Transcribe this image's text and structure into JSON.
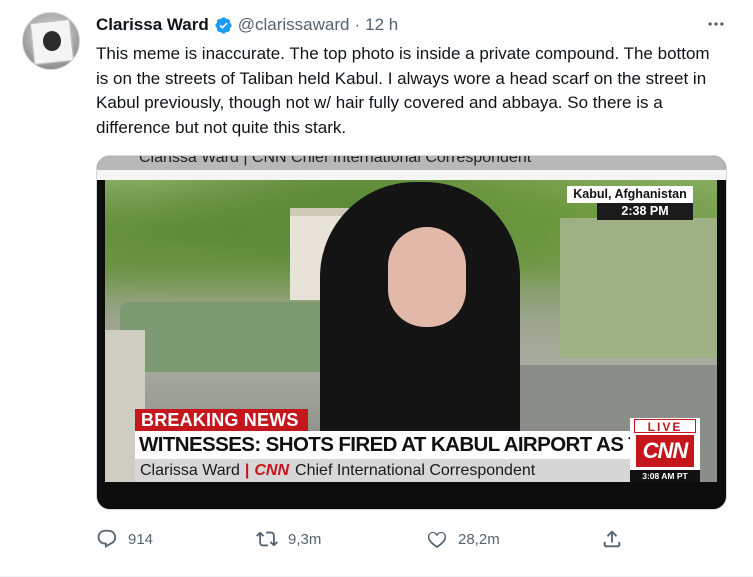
{
  "tweet": {
    "author": {
      "display_name": "Clarissa Ward",
      "handle": "@clarissaward",
      "separator": "·",
      "time": "12 h",
      "verified": true
    },
    "more_icon": "more-horizontal-icon",
    "text": "This meme is inaccurate. The top photo is inside a private compound. The bottom is on the streets of Taliban held Kabul. I always wore a head scarf on the street in Kabul previously, though not w/ hair fully covered and abbaya. So there is a difference but not quite this stark.",
    "media": {
      "top_strip_text": "Clarissa Ward | CNN Chief International Correspondent",
      "location": "Kabul, Afghanistan",
      "location_time": "2:38 PM",
      "breaking": "BREAKING NEWS",
      "headline": "WITNESSES: SHOTS FIRED AT KABUL AIRPORT AS THOUSANDS TRY TO LEAVE",
      "name": "Clarissa Ward",
      "network": "CNN",
      "title": "Chief International Correspondent",
      "live": "LIVE",
      "logo": "CNN",
      "live_time": "3:08 AM PT",
      "colors": {
        "cnn_red": "#c4161c"
      }
    },
    "actions": {
      "reply_count": "914",
      "retweet_count": "9,3m",
      "like_count": "28,2m",
      "icons": [
        "reply-icon",
        "retweet-icon",
        "like-icon",
        "share-icon"
      ]
    },
    "colors": {
      "verified_blue": "#1d9bf0",
      "secondary_text": "#536471"
    }
  }
}
